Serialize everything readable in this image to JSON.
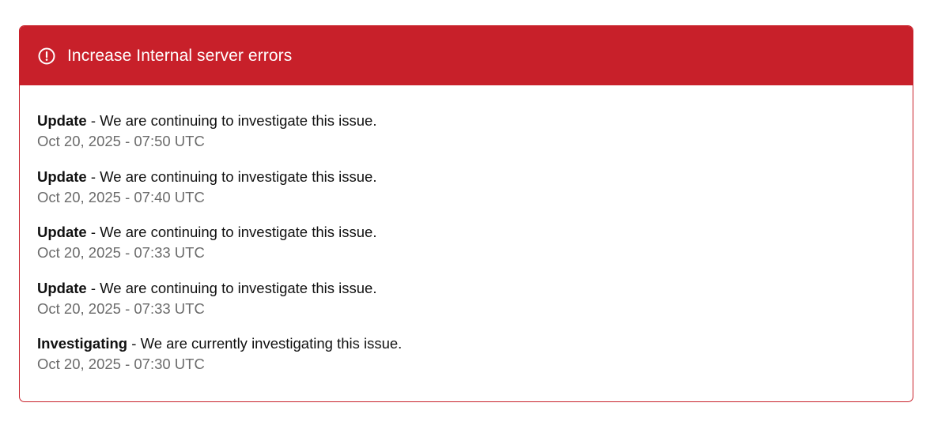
{
  "incident": {
    "title": "Increase Internal server errors",
    "icon": "alert-circle-icon",
    "accent_color": "#c8202a",
    "updates": [
      {
        "status": "Update",
        "separator": " - ",
        "message": "We are continuing to investigate this issue.",
        "time": "Oct 20, 2025 - 07:50 UTC"
      },
      {
        "status": "Update",
        "separator": " - ",
        "message": "We are continuing to investigate this issue.",
        "time": "Oct 20, 2025 - 07:40 UTC"
      },
      {
        "status": "Update",
        "separator": " - ",
        "message": "We are continuing to investigate this issue.",
        "time": "Oct 20, 2025 - 07:33 UTC"
      },
      {
        "status": "Update",
        "separator": " - ",
        "message": "We are continuing to investigate this issue.",
        "time": "Oct 20, 2025 - 07:33 UTC"
      },
      {
        "status": "Investigating",
        "separator": " - ",
        "message": "We are currently investigating this issue.",
        "time": "Oct 20, 2025 - 07:30 UTC"
      }
    ]
  }
}
